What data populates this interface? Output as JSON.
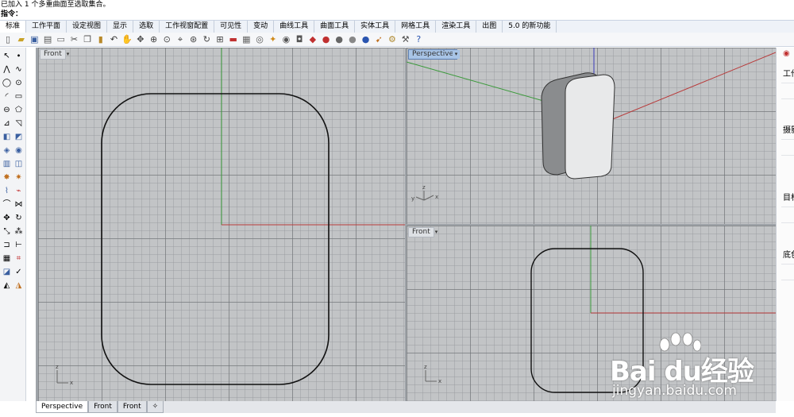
{
  "command": {
    "history": "已加入 1 个多重曲面至选取集合。",
    "prompt": "指令："
  },
  "tabs": [
    "标准",
    "工作平面",
    "设定视图",
    "显示",
    "选取",
    "工作视窗配置",
    "可见性",
    "变动",
    "曲线工具",
    "曲面工具",
    "实体工具",
    "网格工具",
    "渲染工具",
    "出图",
    "5.0 的新功能"
  ],
  "viewports": {
    "front_left": {
      "label": "Front"
    },
    "perspective": {
      "label": "Perspective"
    },
    "front_right": {
      "label": "Front"
    }
  },
  "axes": {
    "x": "x",
    "y": "y",
    "z": "z"
  },
  "bottom_tabs": [
    "Perspective",
    "Front",
    "Front"
  ],
  "bottom_tab_add": "✧",
  "right_panel": {
    "labels": [
      "工作",
      "摄影",
      "目标",
      "底色"
    ]
  },
  "watermark": {
    "brand": "Bai du经验",
    "url": "jingyan.baidu.com"
  },
  "colors": {
    "x_axis": "#b83a3a",
    "y_axis": "#3a9a3a",
    "z_axis": "#3a3ab8",
    "active_label": "#a8c4e6",
    "curve": "#111111"
  },
  "icons": {
    "viewport_menu": "▾"
  }
}
